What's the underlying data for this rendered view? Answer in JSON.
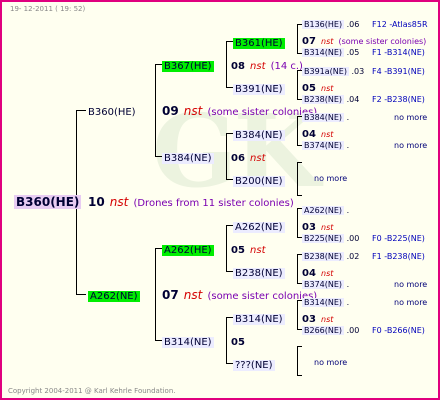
{
  "header": {
    "date": "19- 12-2011 ( 19: 52)"
  },
  "footer": {
    "copyright": "Copyright 2004-2011 @ Karl Kehrle Foundation."
  },
  "watermark": {
    "text": "GK"
  },
  "tree": {
    "root": {
      "id": "B360(HE)",
      "gen": "10",
      "nst": "nst",
      "note": "(Drones from 11 sister colonies)"
    },
    "b360": {
      "id": "B360(HE)",
      "gen": "09",
      "nst": "nst",
      "note": "(some sister colonies)"
    },
    "b367": {
      "id": "B367(HE)",
      "gen": "08",
      "nst": "nst",
      "note": "(14 c.)"
    },
    "b361": {
      "id": "B361(HE)",
      "gen": "07",
      "nst": "nst",
      "note": "(some sister colonies)"
    },
    "b136": {
      "id": "B136(HE)",
      "score": ".06",
      "code": "F12 -Atlas85R"
    },
    "b314a": {
      "id": "B314(NE)",
      "score": ".05",
      "code": "F1 -B314(NE)"
    },
    "b391": {
      "id": "B391(NE)",
      "gen": "05",
      "nst": "nst"
    },
    "b391a": {
      "id": "B391a(NE)",
      "score": ".03",
      "code": "F4 -B391(NE)"
    },
    "b238a": {
      "id": "B238(NE)",
      "score": ".04",
      "code": "F2 -B238(NE)"
    },
    "b384": {
      "id": "B384(NE)",
      "gen": "06",
      "nst": "nst"
    },
    "b384b": {
      "id": "B384(NE)",
      "gen": "04",
      "nst": "nst"
    },
    "b384c": {
      "id": "B384(NE)",
      "dot": ".",
      "more": "no more"
    },
    "b374a": {
      "id": "B374(NE)",
      "dot": ".",
      "more": "no more"
    },
    "b200": {
      "id": "B200(NE)",
      "more": "no more"
    },
    "a262": {
      "id": "A262(NE)",
      "gen": "07",
      "nst": "nst",
      "note": "(some sister colonies)"
    },
    "a262b": {
      "id": "A262(HE)",
      "gen": "05",
      "nst": "nst"
    },
    "a262c": {
      "id": "A262(NE)",
      "gen": "03",
      "nst": "nst"
    },
    "a262d": {
      "id": "A262(NE)",
      "dot": "."
    },
    "b225": {
      "id": "B225(NE)",
      "score": ".00",
      "code": "F0 -B225(NE)"
    },
    "b238": {
      "id": "B238(NE)",
      "gen": "04",
      "nst": "nst"
    },
    "b238b": {
      "id": "B238(NE)",
      "score": ".02",
      "code": "F1 -B238(NE)"
    },
    "b374b": {
      "id": "B374(NE)",
      "dot": ".",
      "more": "no more"
    },
    "b314": {
      "id": "B314(NE)",
      "gen": "05"
    },
    "b314b": {
      "id": "B314(NE)",
      "gen": "03",
      "nst": "nst"
    },
    "b314c": {
      "id": "B314(NE)",
      "dot": ".",
      "more": "no more"
    },
    "b266": {
      "id": "B266(NE)",
      "score": ".00",
      "code": "F0 -B266(NE)"
    },
    "unk": {
      "id": "???(NE)",
      "more": "no more"
    }
  }
}
